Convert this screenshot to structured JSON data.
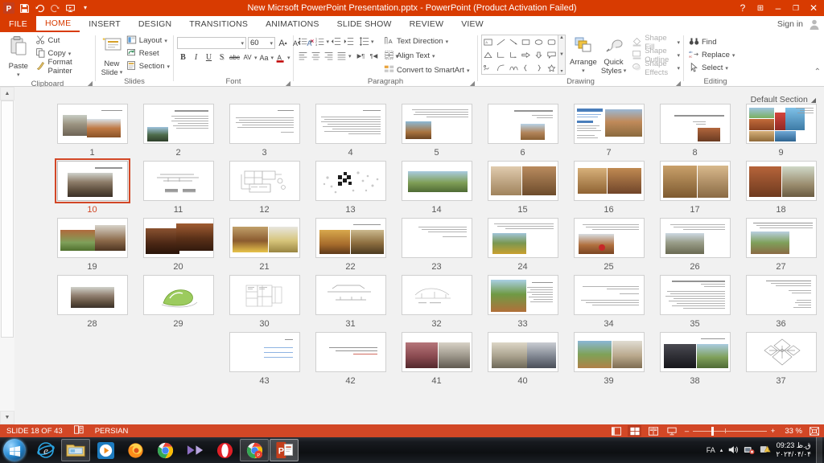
{
  "titlebar": {
    "title": "New Micrsoft PowerPoint Presentation.pptx  -  PowerPoint (Product Activation Failed)",
    "qat": [
      {
        "name": "powerpoint-logo",
        "label": "P"
      },
      {
        "name": "save-icon",
        "label": "Save"
      },
      {
        "name": "undo-icon",
        "label": "Undo"
      },
      {
        "name": "redo-icon",
        "label": "Redo"
      },
      {
        "name": "start-slideshow-icon",
        "label": "Start From Beginning"
      },
      {
        "name": "customize-quick-access-toolbar",
        "label": "▾"
      }
    ],
    "help": "?",
    "ribbon_display_options": "⊞",
    "minimize": "–",
    "restore": "❐",
    "close": "✕"
  },
  "tabs": {
    "file": "FILE",
    "items": [
      "HOME",
      "INSERT",
      "DESIGN",
      "TRANSITIONS",
      "ANIMATIONS",
      "SLIDE SHOW",
      "REVIEW",
      "VIEW"
    ],
    "active": "HOME",
    "signin": "Sign in"
  },
  "ribbon": {
    "clipboard": {
      "label": "Clipboard",
      "paste": "Paste",
      "cut": "Cut",
      "copy": "Copy",
      "format_painter": "Format Painter"
    },
    "slides": {
      "label": "Slides",
      "new_slide": "New\nSlide",
      "new_slide_l1": "New",
      "new_slide_l2": "Slide",
      "layout": "Layout",
      "reset": "Reset",
      "section": "Section"
    },
    "font": {
      "label": "Font",
      "font_name": "",
      "font_size": "60",
      "bold": "B",
      "italic": "I",
      "underline": "U",
      "shadow": "S",
      "strikethrough": "abc",
      "character_spacing": "AV",
      "change_case": "Aa",
      "increase_font": "A",
      "decrease_font": "A",
      "clear_formatting": "",
      "font_color": "A"
    },
    "paragraph": {
      "label": "Paragraph",
      "text_direction": "Text Direction",
      "align_text": "Align Text",
      "convert_to_smartart": "Convert to SmartArt"
    },
    "drawing": {
      "label": "Drawing",
      "arrange": "Arrange",
      "quick_styles_l1": "Quick",
      "quick_styles_l2": "Styles",
      "shape_fill": "Shape Fill",
      "shape_outline": "Shape Outline",
      "shape_effects": "Shape Effects"
    },
    "editing": {
      "label": "Editing",
      "find": "Find",
      "replace": "Replace",
      "select": "Select"
    },
    "collapse_ribbon": "⌃"
  },
  "sorter": {
    "section_label": "Default Section",
    "selected_slide": 18,
    "rows": [
      [
        {
          "n": 1,
          "type": "photo-collage",
          "title": "فقط مد افکار و سریب"
        },
        {
          "n": 2,
          "type": "title-photo",
          "title": "مرکز کودکان بی سرپرست"
        },
        {
          "n": 3,
          "type": "screenshot-photo",
          "title": ""
        },
        {
          "n": 4,
          "type": "text-photo",
          "title": ""
        },
        {
          "n": 5,
          "type": "text-photo",
          "title": ""
        },
        {
          "n": 6,
          "type": "text-only",
          "title": "متن تخصصی"
        },
        {
          "n": 7,
          "type": "text-only",
          "title": "مرتبط اموزی"
        },
        {
          "n": 8,
          "type": "text-photo",
          "title": "برنامه ریزی فضایی"
        },
        {
          "n": 9,
          "type": "two-photo",
          "title": "تصاویر داخلی و خارجی"
        }
      ],
      [
        {
          "n": 10,
          "type": "two-photo",
          "title": ""
        },
        {
          "n": 11,
          "type": "interior-photo",
          "title": ""
        },
        {
          "n": 12,
          "type": "interior-photo",
          "title": ""
        },
        {
          "n": 13,
          "type": "interior-photo",
          "title": ""
        },
        {
          "n": 14,
          "type": "landscape-photo",
          "title": ""
        },
        {
          "n": 15,
          "type": "diagram-dots",
          "title": ""
        },
        {
          "n": 16,
          "type": "plan-drawing",
          "title": ""
        },
        {
          "n": 17,
          "type": "section-drawing",
          "title": ""
        },
        {
          "n": 18,
          "type": "title-photo",
          "title": "مرکز رشد کودکان از پروژه"
        }
      ],
      [
        {
          "n": 19,
          "type": "text-photo",
          "title": ""
        },
        {
          "n": 20,
          "type": "text-photo",
          "title": ""
        },
        {
          "n": 21,
          "type": "text-photo",
          "title": ""
        },
        {
          "n": 22,
          "type": "text-photo",
          "title": ""
        },
        {
          "n": 23,
          "type": "text-only",
          "title": ""
        },
        {
          "n": 24,
          "type": "two-photo",
          "title": "تصاویر داخلی و خارجی پروژه"
        },
        {
          "n": 25,
          "type": "two-photo",
          "title": ""
        },
        {
          "n": 26,
          "type": "two-photo",
          "title": ""
        },
        {
          "n": 27,
          "type": "two-photo",
          "title": ""
        }
      ],
      [
        {
          "n": 28,
          "type": "landscape-photo",
          "title": ""
        },
        {
          "n": 29,
          "type": "site-diagram",
          "title": ""
        },
        {
          "n": 30,
          "type": "plan-drawing",
          "title": ""
        },
        {
          "n": 31,
          "type": "section-drawing",
          "title": ""
        },
        {
          "n": 32,
          "type": "section-drawing",
          "title": ""
        },
        {
          "n": 33,
          "type": "text-photo",
          "title": ""
        },
        {
          "n": 34,
          "type": "text-only",
          "title": ""
        },
        {
          "n": 35,
          "type": "text-only",
          "title": ""
        },
        {
          "n": 36,
          "type": "text-only",
          "title": ""
        }
      ],
      [
        {
          "n": 37,
          "type": "diagram-dots",
          "title": ""
        },
        {
          "n": 38,
          "type": "two-photo",
          "title": "تصاویر داخلی و خارجی"
        },
        {
          "n": 39,
          "type": "two-photo",
          "title": ""
        },
        {
          "n": 40,
          "type": "two-photo",
          "title": ""
        },
        {
          "n": 41,
          "type": "interior-photo",
          "title": ""
        },
        {
          "n": 42,
          "type": "text-only",
          "title": ""
        },
        {
          "n": 43,
          "type": "bullets",
          "title": "ختم"
        }
      ]
    ]
  },
  "status": {
    "slide_indicator": "SLIDE 18 OF 43",
    "language": "PERSIAN",
    "views": [
      {
        "name": "normal-view-button",
        "label": "▤"
      },
      {
        "name": "slide-sorter-view-button",
        "label": "▦"
      },
      {
        "name": "reading-view-button",
        "label": "▥"
      },
      {
        "name": "slide-show-button",
        "label": "▷"
      }
    ],
    "active_view": "slide-sorter-view-button",
    "zoom_out": "–",
    "zoom_in": "+",
    "zoom_level": "33 %",
    "fit_to_window": "⛶"
  },
  "taskbar": {
    "start": "start-orb",
    "items": [
      {
        "name": "taskbar-internet-explorer",
        "label": "e"
      },
      {
        "name": "taskbar-windows-explorer",
        "label": "Explorer"
      },
      {
        "name": "taskbar-media-player",
        "label": "Media Player"
      },
      {
        "name": "taskbar-firefox",
        "label": "Firefox"
      },
      {
        "name": "taskbar-chrome",
        "label": "Chrome"
      },
      {
        "name": "taskbar-movie-maker",
        "label": "Movie Maker"
      },
      {
        "name": "taskbar-opera",
        "label": "Opera"
      },
      {
        "name": "taskbar-chrome-canary",
        "label": "Chrome Canary"
      },
      {
        "name": "taskbar-powerpoint",
        "label": "PowerPoint"
      }
    ],
    "tray": {
      "language": "FA",
      "show_hidden_icons": "▴",
      "volume": "volume-icon",
      "network": "network-icon",
      "action_center": "action-center-icon",
      "time": "ق.ظ 09:23",
      "date": "۲۰۲۴/۰۴/۰۴"
    }
  }
}
